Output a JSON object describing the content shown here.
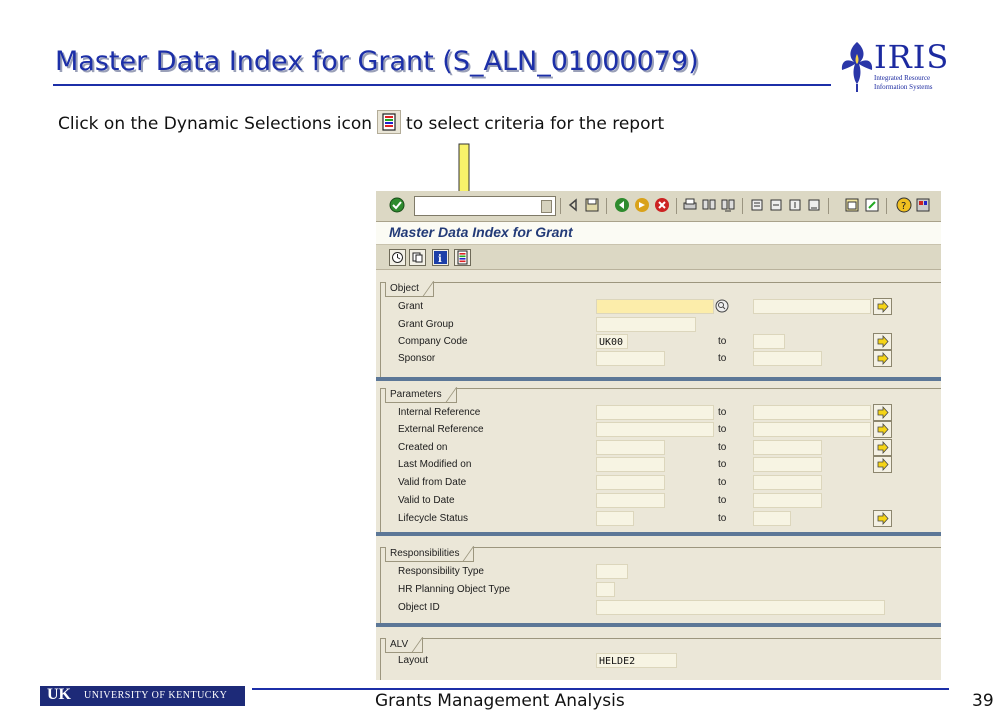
{
  "slide": {
    "title": "Master Data Index for Grant (S_ALN_01000079)",
    "instruction_before": "Click on the Dynamic Selections icon",
    "instruction_after": "to select criteria for the report",
    "footer_title": "Grants Management Analysis",
    "page_number": "39",
    "accent_color": "#1c2fa8"
  },
  "logo": {
    "brand": "IRIS",
    "line1": "Integrated Resource",
    "line2": "Information Systems"
  },
  "footer_logo": {
    "mark": "UK",
    "name": "UNIVERSITY OF KENTUCKY"
  },
  "sap": {
    "screen_title": "Master Data Index for Grant",
    "command_field": "",
    "toolbar_icons": [
      "enter-icon",
      "back-icon",
      "save-icon",
      "green-back-icon",
      "exit-icon",
      "cancel-icon",
      "print-icon",
      "find-icon",
      "find-next-icon",
      "first-page-icon",
      "previous-page-icon",
      "next-page-icon",
      "last-page-icon",
      "new-session-icon",
      "shortcut-icon",
      "help-icon",
      "layout-icon"
    ],
    "app_toolbar_icons": [
      "execute-icon",
      "get-variant-icon",
      "info-icon",
      "dynamic-selections-icon"
    ],
    "groups": {
      "object": {
        "title": "Object",
        "rows": [
          {
            "label": "Grant",
            "from": "",
            "to_label": "",
            "to": ""
          },
          {
            "label": "Grant Group",
            "from": ""
          },
          {
            "label": "Company Code",
            "from": "UK00",
            "to_label": "to",
            "to": ""
          },
          {
            "label": "Sponsor",
            "from": "",
            "to_label": "to",
            "to": ""
          }
        ]
      },
      "parameters": {
        "title": "Parameters",
        "rows": [
          {
            "label": "Internal Reference",
            "to_label": "to"
          },
          {
            "label": "External Reference",
            "to_label": "to"
          },
          {
            "label": "Created on",
            "to_label": "to"
          },
          {
            "label": "Last Modified on",
            "to_label": "to"
          },
          {
            "label": "Valid from Date",
            "to_label": "to"
          },
          {
            "label": "Valid to Date",
            "to_label": "to"
          },
          {
            "label": "Lifecycle Status",
            "to_label": "to"
          }
        ]
      },
      "responsibilities": {
        "title": "Responsibilities",
        "rows": [
          {
            "label": "Responsibility Type",
            "value": ""
          },
          {
            "label": "HR Planning Object Type",
            "value": ""
          },
          {
            "label": "Object ID",
            "value": ""
          }
        ]
      },
      "alv": {
        "title": "ALV",
        "rows": [
          {
            "label": "Layout",
            "value": "HELDE2"
          }
        ]
      }
    }
  }
}
